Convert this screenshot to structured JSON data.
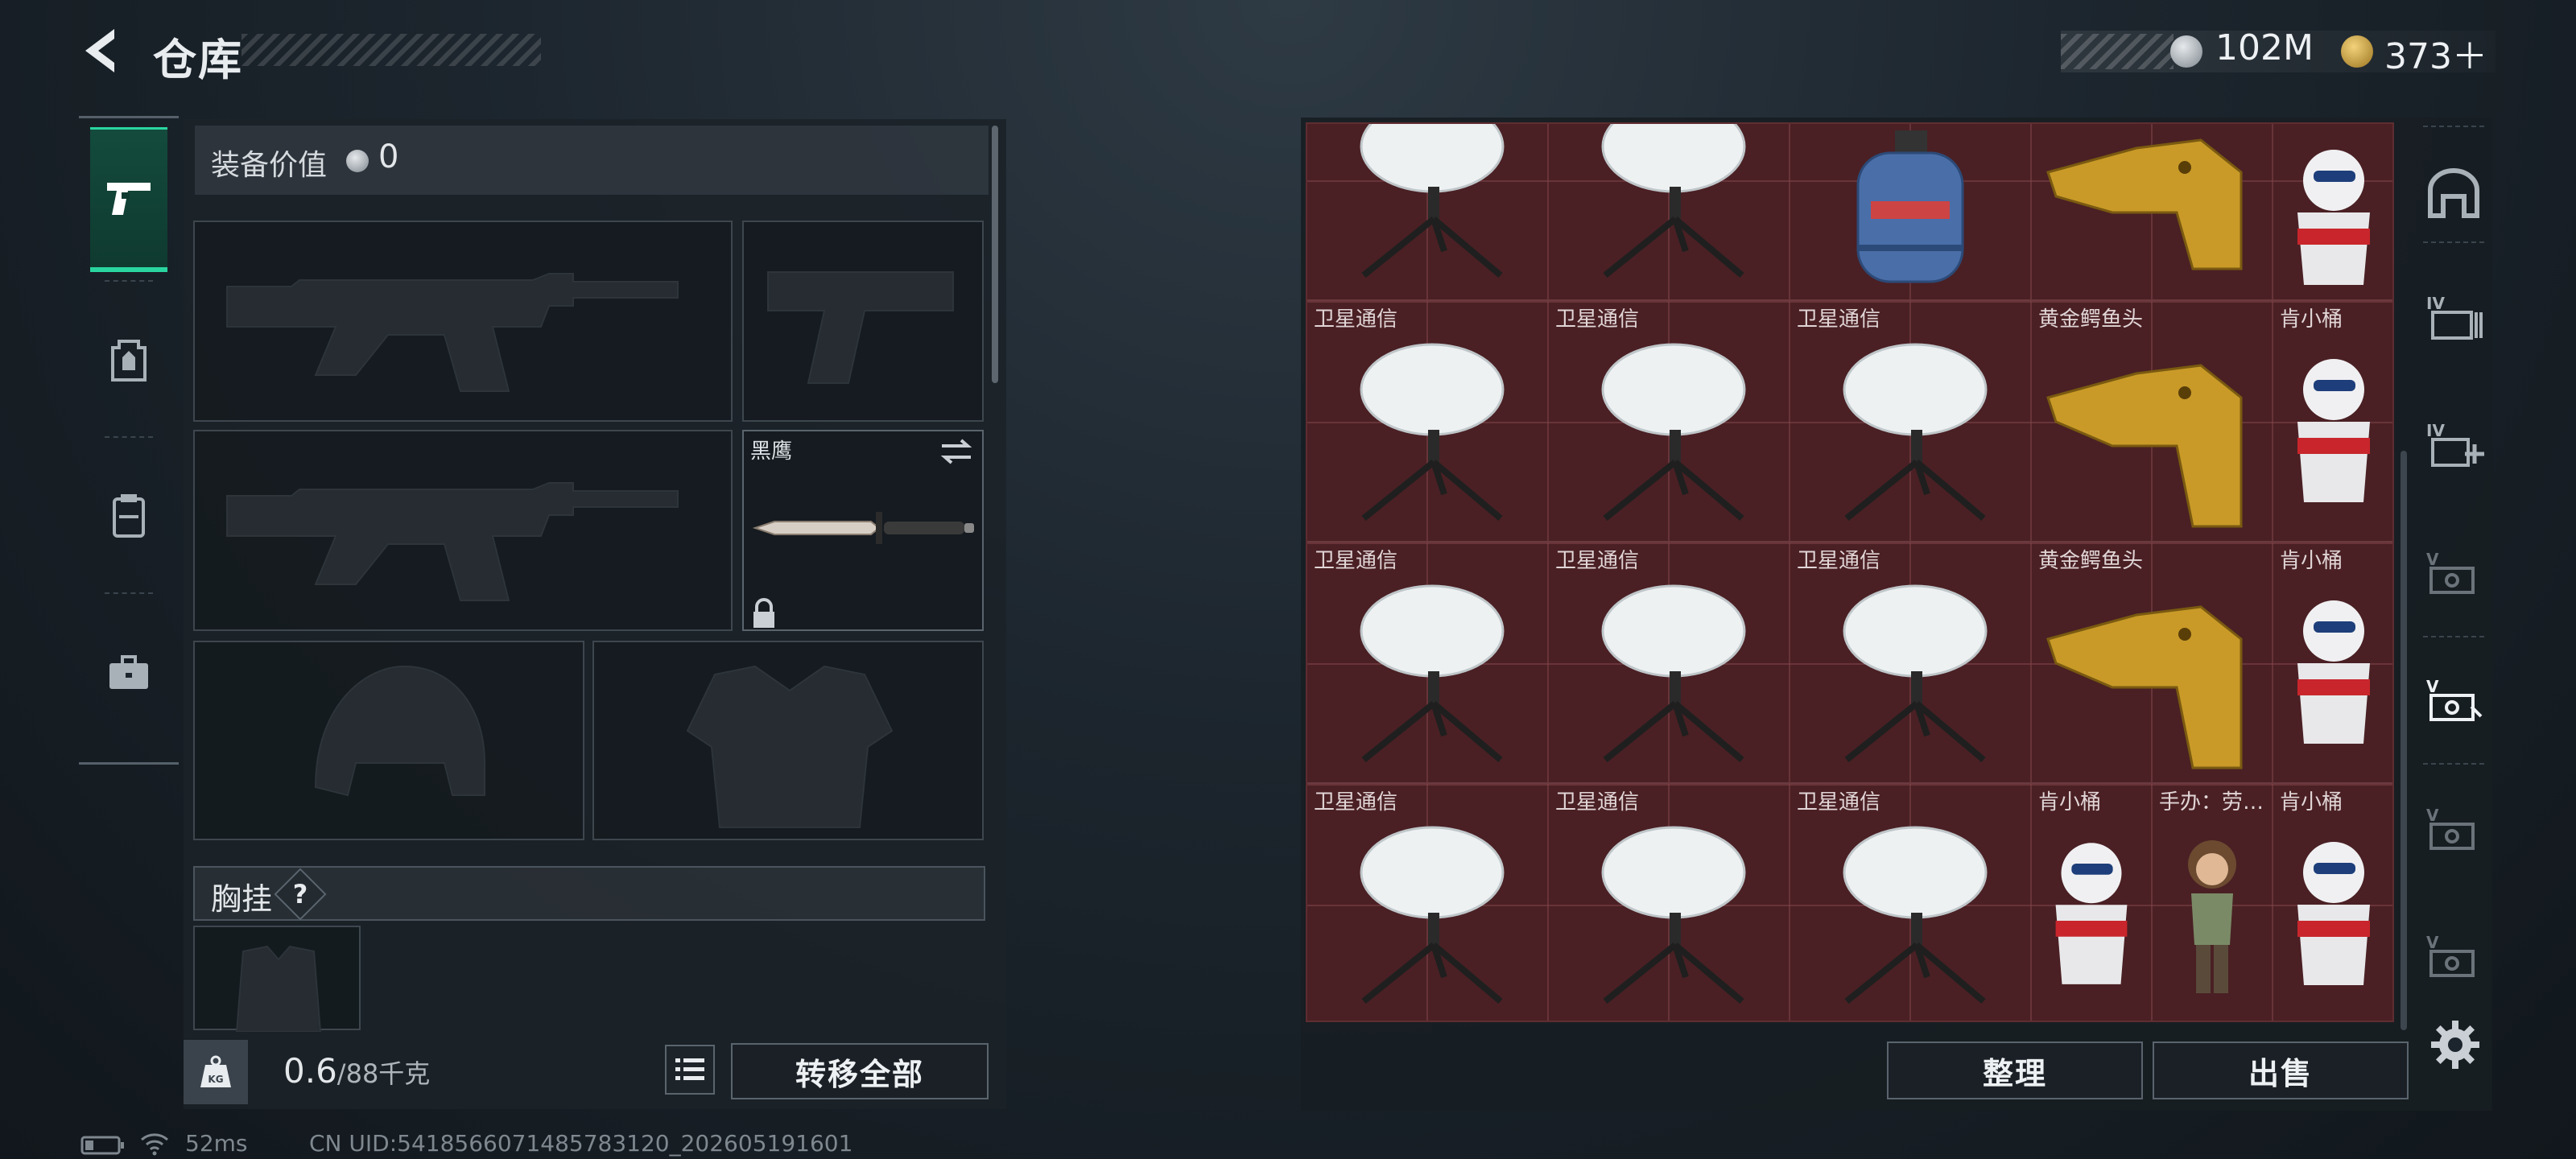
{
  "header": {
    "title": "仓库"
  },
  "currency": {
    "silver": "102M",
    "gold": "373＋"
  },
  "loadout": {
    "value_label": "装备价值",
    "value": "0",
    "melee_slot": {
      "name": "黑鹰"
    },
    "chest_rig_label": "胸挂",
    "chest_rig_help": "?",
    "weight": "0.6",
    "weight_max": "/88千克",
    "transfer_all": "转移全部"
  },
  "stash": {
    "row0": [
      "",
      "",
      "",
      "",
      ""
    ],
    "row1": [
      "卫星通信",
      "卫星通信",
      "卫星通信",
      "黄金鳄鱼头",
      "肯小桶"
    ],
    "row2": [
      "卫星通信",
      "卫星通信",
      "卫星通信",
      "黄金鳄鱼头",
      "肯小桶"
    ],
    "row3": [
      "卫星通信",
      "卫星通信",
      "卫星通信",
      "肯小桶",
      "手办：劳…",
      "肯小桶"
    ],
    "sort": "整理",
    "sell": "出售"
  },
  "status": {
    "ping": "52ms",
    "uid": "CN UID:5418566071485783120_202605191601"
  },
  "colors": {
    "accent_green": "#2ad6a0",
    "stash_bg": "#4a2024"
  }
}
